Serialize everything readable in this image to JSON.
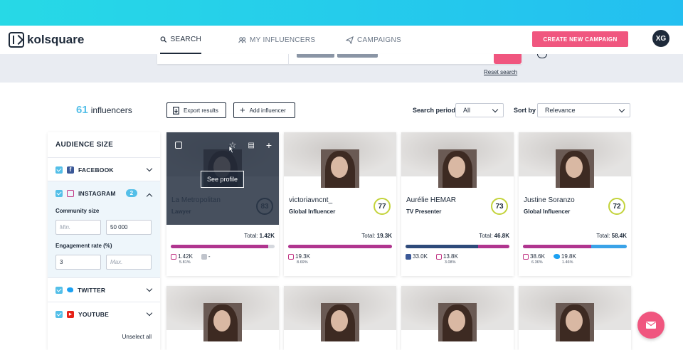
{
  "brand": {
    "name": "kolsquare"
  },
  "nav": {
    "tabs": [
      {
        "label": "SEARCH",
        "active": true
      },
      {
        "label": "MY INFLUENCERS",
        "active": false
      },
      {
        "label": "CAMPAIGNS",
        "active": false
      }
    ],
    "create_button": "CREATE NEW CAMPAIGN",
    "avatar_initials": "XG"
  },
  "search": {
    "reset_label": "Reset search"
  },
  "results": {
    "count": "61",
    "count_label": "influencers",
    "export_label": "Export results",
    "add_label": "Add influencer",
    "period_label": "Search period",
    "period_value": "All",
    "sort_label": "Sort by",
    "sort_value": "Relevance"
  },
  "filters": {
    "title": "AUDIENCE SIZE",
    "facebook": "FACEBOOK",
    "instagram": "INSTAGRAM",
    "instagram_badge": "2",
    "community_label": "Community size",
    "min_placeholder": "Min.",
    "community_max": "50 000",
    "engagement_label": "Engagement rate (%)",
    "engagement_min": "3",
    "max_placeholder": "Max.",
    "twitter": "TWITTER",
    "youtube": "YOUTUBE",
    "unselect": "Unselect all"
  },
  "cards": [
    {
      "name": "La Metropolitan",
      "role": "Lawyer",
      "score": "83",
      "total_label": "Total:",
      "total": "1.42K",
      "overlay": true,
      "see_profile": "See profile",
      "stats": [
        {
          "network": "instagram",
          "value": "1.42K",
          "eng": "5.81%"
        },
        {
          "network": "facebook-gray",
          "value": "-",
          "eng": ""
        }
      ],
      "bar": [
        {
          "pct": 94,
          "color": "#b0358f"
        }
      ]
    },
    {
      "name": "victoriavncnt_",
      "role": "Global Influencer",
      "score": "77",
      "total_label": "Total:",
      "total": "19.3K",
      "overlay": false,
      "stats": [
        {
          "network": "instagram",
          "value": "19.3K",
          "eng": "8.69%"
        }
      ],
      "bar": [
        {
          "pct": 100,
          "color": "#b0358f"
        }
      ]
    },
    {
      "name": "Aurélie HEMAR",
      "role": "TV Presenter",
      "score": "73",
      "total_label": "Total:",
      "total": "46.8K",
      "overlay": false,
      "stats": [
        {
          "network": "facebook",
          "value": "33.0K",
          "eng": ""
        },
        {
          "network": "instagram",
          "value": "13.8K",
          "eng": "3.08%"
        }
      ],
      "bar": [
        {
          "pct": 70,
          "color": "#2e4a7a"
        },
        {
          "pct": 30,
          "color": "#b0358f"
        }
      ]
    },
    {
      "name": "Justine Soranzo",
      "role": "Global Influencer",
      "score": "72",
      "total_label": "Total:",
      "total": "58.4K",
      "overlay": false,
      "stats": [
        {
          "network": "instagram",
          "value": "38.6K",
          "eng": "6.36%"
        },
        {
          "network": "twitter",
          "value": "19.8K",
          "eng": "1.46%"
        }
      ],
      "bar": [
        {
          "pct": 66,
          "color": "#b0358f"
        },
        {
          "pct": 34,
          "color": "#3aa3e8"
        }
      ]
    }
  ],
  "colors": {
    "accent": "#f0567f",
    "primary": "#1e2a3a",
    "light_blue": "#54bfe8"
  }
}
